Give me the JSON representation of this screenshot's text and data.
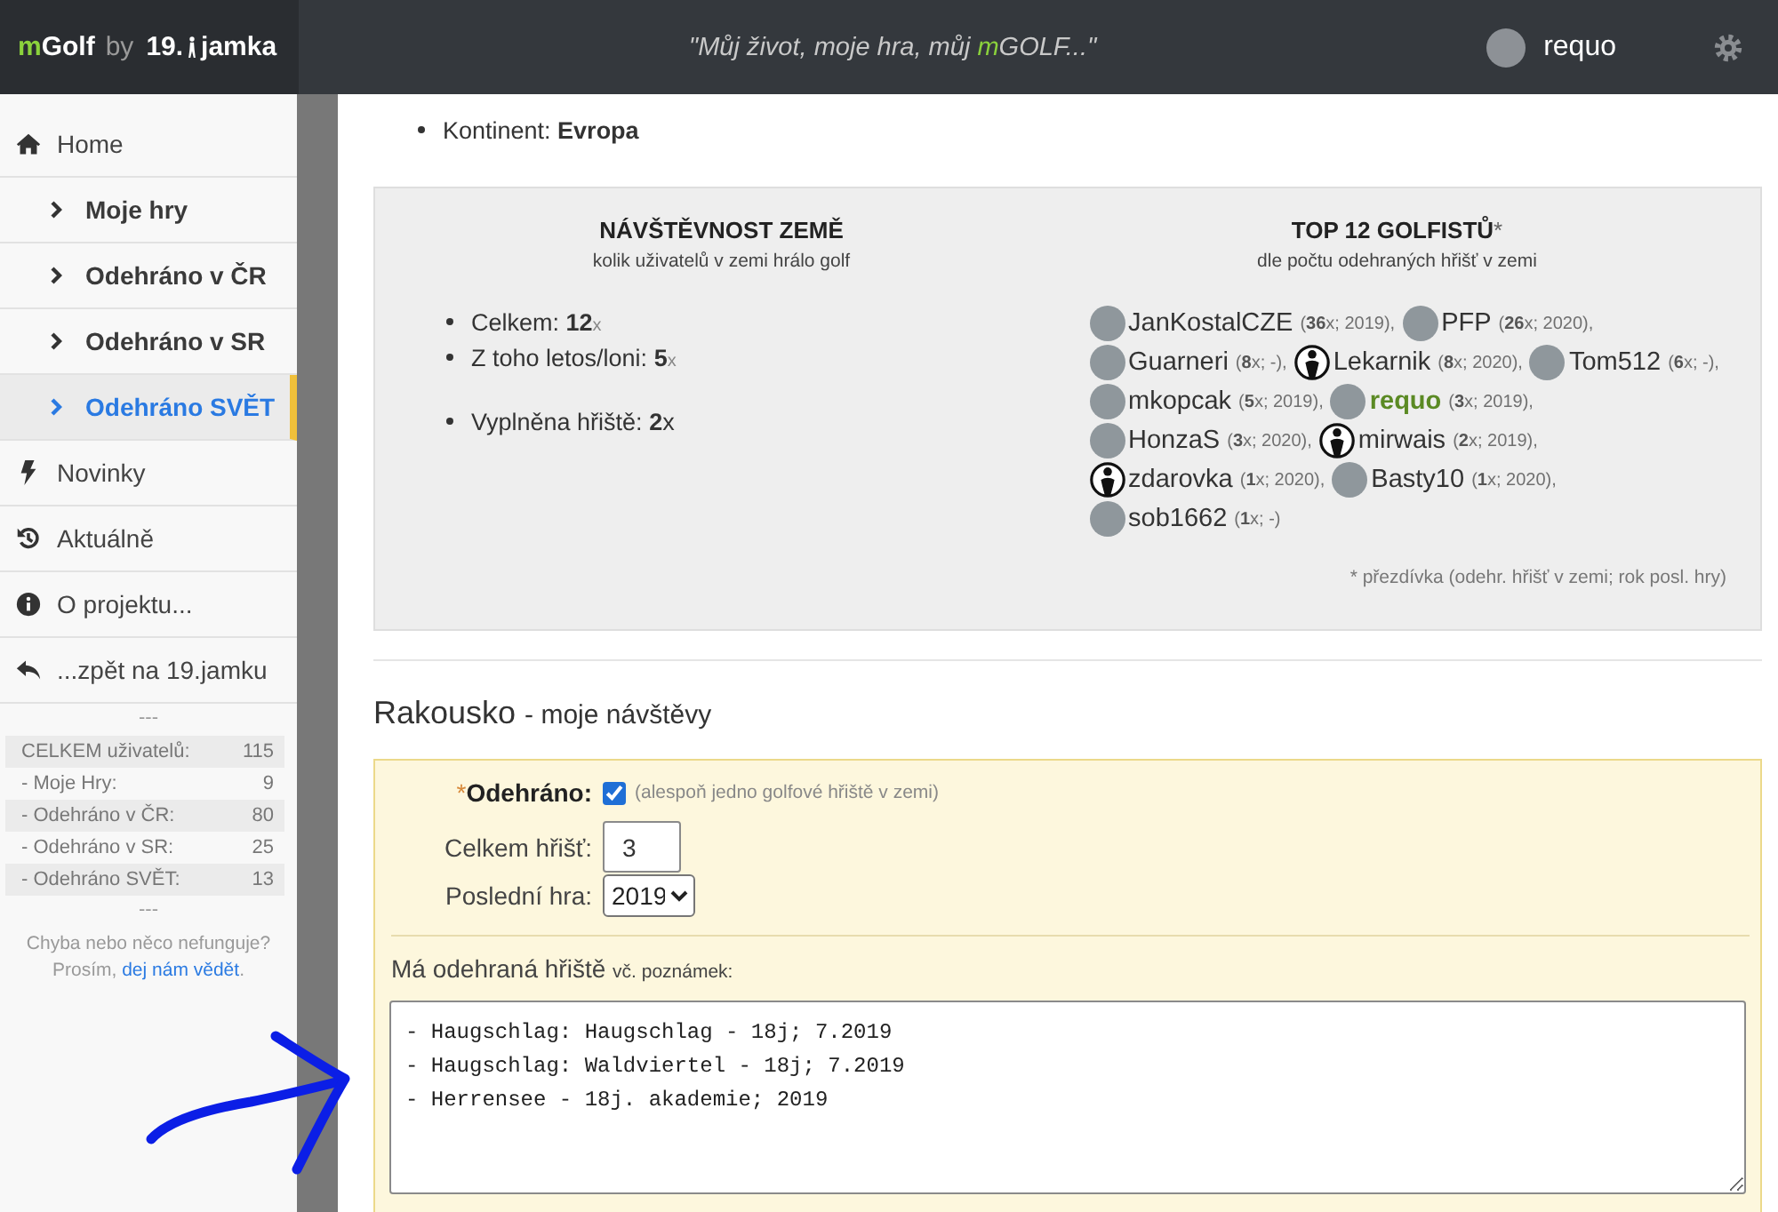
{
  "header": {
    "logo": {
      "brand_accent": "m",
      "brand": "Golf",
      "by": "by",
      "partner_number": "19.",
      "partner": "jamka"
    },
    "quote": {
      "before": "\"Můj život, moje hra, můj ",
      "accent": "m",
      "after": "GOLF...\""
    },
    "user": {
      "name": "requo"
    }
  },
  "sidebar": {
    "items": [
      {
        "label": "Home",
        "selected": false,
        "children": [
          {
            "label": "Moje hry",
            "selected": false
          },
          {
            "label": "Odehráno v ČR",
            "selected": false
          },
          {
            "label": "Odehráno v SR",
            "selected": false
          },
          {
            "label": "Odehráno SVĚT",
            "selected": true
          }
        ]
      },
      {
        "label": "Novinky",
        "selected": false
      },
      {
        "label": "Aktuálně",
        "selected": false
      },
      {
        "label": "O projektu...",
        "selected": false
      },
      {
        "label": "...zpět na 19.jamku",
        "selected": false
      }
    ],
    "stats_separator": "---",
    "stats": [
      {
        "label": "CELKEM uživatelů:",
        "value": "115"
      },
      {
        "label": "- Moje Hry:",
        "value": "9"
      },
      {
        "label": "- Odehráno v ČR:",
        "value": "80"
      },
      {
        "label": "- Odehráno v SR:",
        "value": "25"
      },
      {
        "label": "- Odehráno SVĚT:",
        "value": "13"
      }
    ],
    "footer_separator": "---",
    "feedback": {
      "text": "Chyba nebo něco nefunguje? Prosím,",
      "link": "dej nám vědět",
      "end": "."
    }
  },
  "country_info": [
    {
      "label": "Kontinent:",
      "value": "Evropa"
    }
  ],
  "visits_panel": {
    "title": "NÁVŠTĚVNOST ZEMĚ",
    "subtitle": "kolik uživatelů v zemi hrálo golf",
    "stat_groups": [
      [
        {
          "label": "Celkem:",
          "value": "12",
          "unit": "x",
          "unit_muted": true
        },
        {
          "label": "Z toho letos/loni:",
          "value": "5",
          "unit": "x",
          "unit_muted": true
        }
      ],
      [
        {
          "label": "Vyplněna hřiště:",
          "value": "2",
          "unit": "x",
          "unit_muted": false
        }
      ]
    ]
  },
  "top_panel": {
    "title": "TOP 12 GOLFISTŮ",
    "title_mark": "*",
    "subtitle": "dle počtu odehraných hřišť v zemi",
    "rows": [
      [
        {
          "name": "JanKostalCZE",
          "kind": "photo",
          "current_user": false,
          "stats": "(**36**x; 2019),"
        },
        {
          "name": "PFP",
          "kind": "photo",
          "current_user": false,
          "stats": "(**26**x; 2020),"
        }
      ],
      [
        {
          "name": "Guarneri",
          "kind": "photo",
          "current_user": false,
          "stats": "(**8**x; -),"
        },
        {
          "name": "Lekarnik",
          "kind": "silhouette",
          "current_user": false,
          "stats": "(**8**x; 2020),"
        },
        {
          "name": "Tom512",
          "kind": "photo",
          "current_user": false,
          "stats": "(**6**x; -),"
        }
      ],
      [
        {
          "name": "mkopcak",
          "kind": "photo",
          "current_user": false,
          "stats": "(**5**x; 2019),"
        },
        {
          "name": "requo",
          "kind": "photo",
          "current_user": true,
          "stats": "(**3**x; 2019),"
        }
      ],
      [
        {
          "name": "HonzaS",
          "kind": "photo",
          "current_user": false,
          "stats": "(**3**x; 2020),"
        },
        {
          "name": "mirwais",
          "kind": "silhouette",
          "current_user": false,
          "stats": "(**2**x; 2019),"
        }
      ],
      [
        {
          "name": "zdarovka",
          "kind": "silhouette",
          "current_user": false,
          "stats": "(**1**x; 2020),"
        },
        {
          "name": "Basty10",
          "kind": "photo",
          "current_user": false,
          "stats": "(**1**x; 2020),"
        }
      ],
      [
        {
          "name": "sob1662",
          "kind": "photo",
          "current_user": false,
          "stats": "(**1**x; -)"
        }
      ]
    ],
    "footnote": "* přezdívka (odehr. hřišť v zemi; rok posl. hry)"
  },
  "visit_form": {
    "title": "Rakousko",
    "subtitle": "- moje návštěvy",
    "played": {
      "required_mark": "*",
      "label": "Odehráno:",
      "checked": true,
      "hint": "(alespoň jedno golfové hřiště v zemi)"
    },
    "total": {
      "label": "Celkem hřišť:",
      "value": "3"
    },
    "last_game": {
      "label": "Poslední hra:",
      "value": "2019"
    },
    "courses": {
      "label": "Má odehraná hřiště",
      "note": "vč. poznámek:",
      "value": "- Haugschlag: Haugschlag - 18j; 7.2019\n- Haugschlag: Waldviertel - 18j; 7.2019\n- Herrensee - 18j. akademie; 2019"
    }
  }
}
